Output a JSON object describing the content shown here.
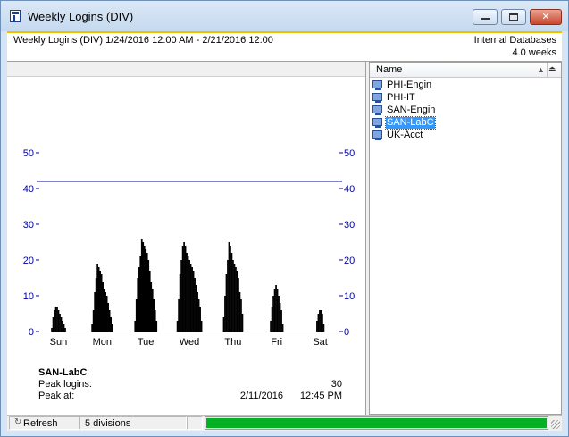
{
  "window": {
    "title": "Weekly Logins (DIV)",
    "controls": {
      "minimize_icon": "minimize-icon",
      "maximize_icon": "maximize-icon",
      "close_glyph": "✕"
    }
  },
  "header": {
    "range_text": "Weekly Logins (DIV) 1/24/2016 12:00 AM - 2/21/2016 12:00",
    "source_text": "Internal Databases",
    "duration_text": "4.0 weeks"
  },
  "chart_data": {
    "type": "bar",
    "title": "",
    "xlabel": "",
    "ylabel": "",
    "ylim": [
      0,
      50
    ],
    "yticks": [
      0,
      10,
      20,
      30,
      40,
      50
    ],
    "categories": [
      "Sun",
      "Mon",
      "Tue",
      "Wed",
      "Thu",
      "Fri",
      "Sat"
    ],
    "reference_line": 42,
    "bar_color": "#000000",
    "axis_color": "#0000a0",
    "series": [
      {
        "values_by_day": [
          [
            1,
            4,
            6,
            7,
            7,
            6,
            5,
            4,
            3,
            2,
            1
          ],
          [
            2,
            6,
            11,
            15,
            19,
            18,
            17,
            16,
            14,
            12,
            11,
            10,
            8,
            6,
            4,
            2
          ],
          [
            3,
            9,
            15,
            18,
            21,
            26,
            25,
            24,
            23,
            22,
            20,
            17,
            14,
            12,
            9,
            6,
            3
          ],
          [
            3,
            9,
            16,
            20,
            24,
            25,
            24,
            22,
            21,
            20,
            19,
            18,
            17,
            15,
            13,
            11,
            9,
            7,
            3
          ],
          [
            4,
            10,
            16,
            20,
            25,
            24,
            22,
            20,
            19,
            18,
            17,
            15,
            11,
            9,
            5
          ],
          [
            3,
            7,
            10,
            12,
            13,
            12,
            10,
            8,
            6,
            2
          ],
          [
            3,
            5,
            6,
            6,
            5,
            2
          ]
        ]
      }
    ]
  },
  "details": {
    "name": "SAN-LabC",
    "peak_logins_label": "Peak logins:",
    "peak_logins_value": "30",
    "peak_at_label": "Peak at:",
    "peak_date": "2/11/2016",
    "peak_time": "12:45 PM"
  },
  "list": {
    "column_name": "Name",
    "sort_icon": "sort-ascending-icon",
    "column_button_icon": "column-chooser-icon",
    "items": [
      {
        "label": "PHI-Engin",
        "icon": "computer-icon",
        "selected": false
      },
      {
        "label": "PHI-IT",
        "icon": "computer-icon",
        "selected": false
      },
      {
        "label": "SAN-Engin",
        "icon": "computer-icon",
        "selected": false
      },
      {
        "label": "SAN-LabC",
        "icon": "computer-icon",
        "selected": true
      },
      {
        "label": "UK-Acct",
        "icon": "computer-icon",
        "selected": false
      }
    ]
  },
  "statusbar": {
    "refresh_label": "Refresh",
    "refresh_icon": "refresh-icon",
    "divisions_text": "5 divisions",
    "progress_fraction": 1.0,
    "progress_color": "#06b025"
  }
}
